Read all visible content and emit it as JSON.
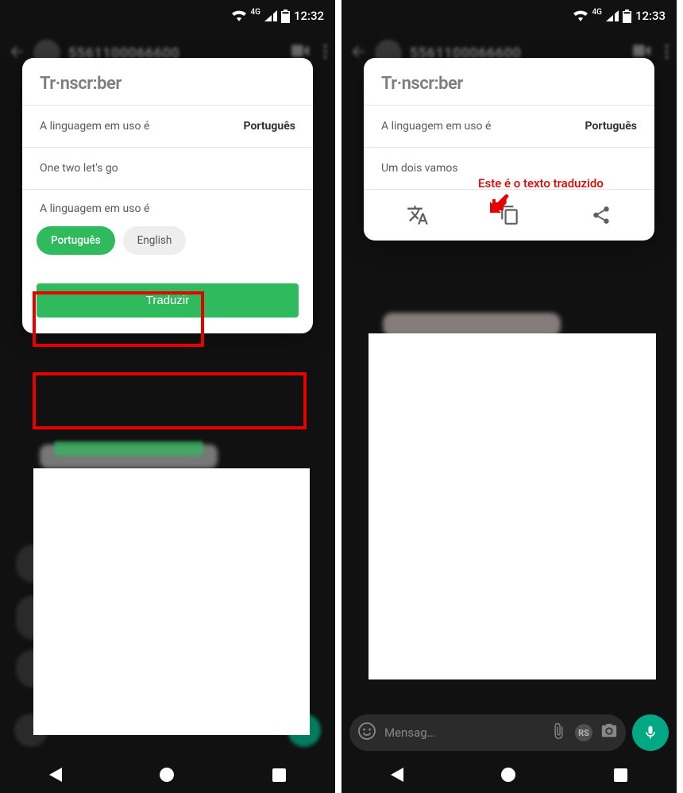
{
  "left": {
    "status": {
      "network": "4G",
      "time": "12:32"
    },
    "header": {
      "contact": "5561100066600"
    },
    "popup": {
      "title": "Tr·nscr:ber",
      "lang_label": "A linguagem em uso é",
      "lang_value": "Português",
      "text": "One two let's go",
      "select_label": "A linguagem em uso é",
      "chip_pt": "Português",
      "chip_en": "English",
      "translate_btn": "Traduzir"
    }
  },
  "right": {
    "status": {
      "network": "4G",
      "time": "12:33"
    },
    "header": {
      "contact": "5561100066600"
    },
    "popup": {
      "title": "Tr·nscr:ber",
      "lang_label": "A linguagem em uso é",
      "lang_value": "Português",
      "text": "Um dois vamos"
    },
    "annotation": "Este é o texto traduzido",
    "compose": {
      "placeholder": "Mensag…",
      "sticker_label": "RS"
    }
  }
}
